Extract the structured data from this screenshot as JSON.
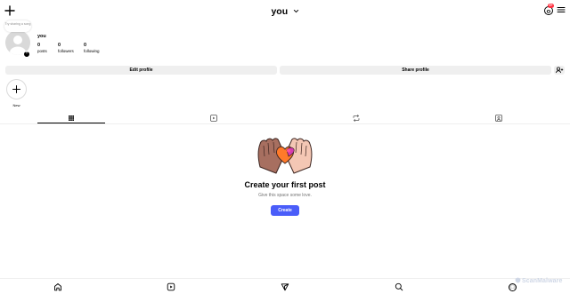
{
  "header": {
    "title": "you",
    "threads_badge": "9+",
    "icons": [
      "plus-icon",
      "chevron-down-icon",
      "threads-icon",
      "menu-icon"
    ]
  },
  "profile": {
    "note_text": "Try sharing a song",
    "username": "you",
    "stats": [
      {
        "count": "0",
        "label": "posts"
      },
      {
        "count": "0",
        "label": "followers"
      },
      {
        "count": "0",
        "label": "following"
      }
    ]
  },
  "actions": {
    "edit_label": "Edit profile",
    "share_label": "Share profile",
    "discover_icon": "add-person-icon"
  },
  "highlights": {
    "new_label": "New"
  },
  "tabs": [
    {
      "icon": "grid-icon",
      "selected": true
    },
    {
      "icon": "reels-icon",
      "selected": false
    },
    {
      "icon": "reposts-icon",
      "selected": false
    },
    {
      "icon": "tagged-icon",
      "selected": false
    }
  ],
  "empty_state": {
    "title": "Create your first post",
    "subtitle": "Give this space some love.",
    "button_label": "Create"
  },
  "bottom_nav": [
    "home-icon",
    "reels-icon",
    "send-icon",
    "search-icon",
    "profile-avatar"
  ],
  "watermark": "ScanMalware",
  "colors": {
    "accent": "#4a5df9",
    "badge": "#ff3040",
    "button_bg": "#efefef",
    "muted_text": "#737373"
  }
}
